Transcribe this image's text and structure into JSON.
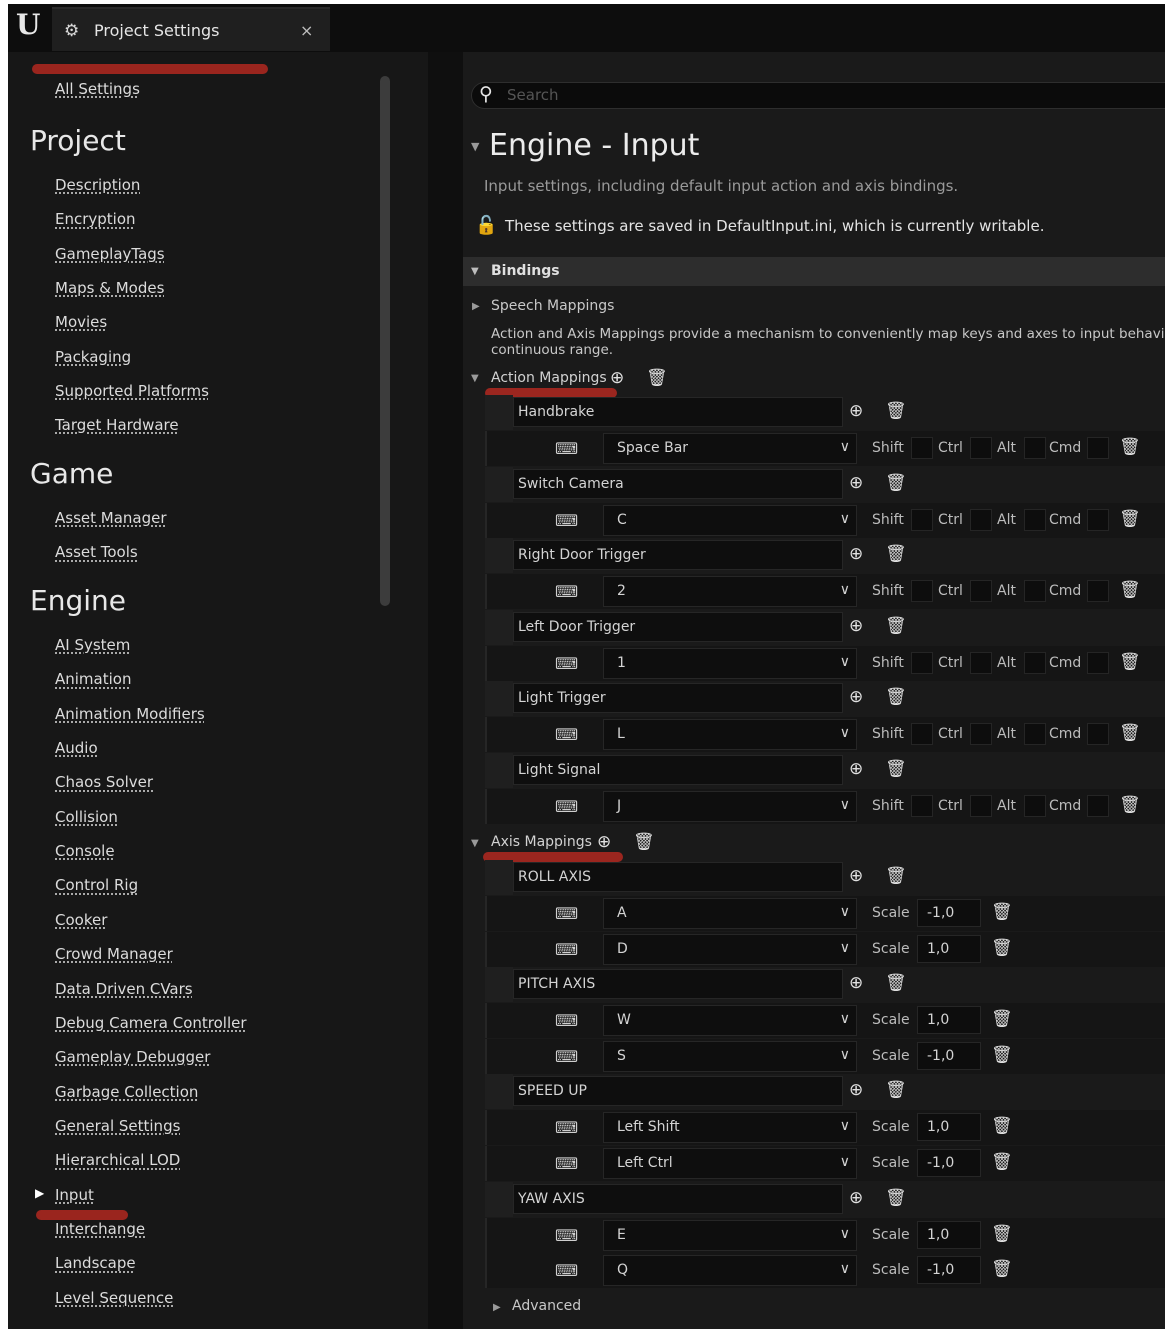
{
  "window": {
    "logo_text": "U",
    "tab_title": "Project Settings",
    "tab_close": "×"
  },
  "sidebar": {
    "all_settings": "All Settings",
    "project_heading": "Project",
    "project_items": [
      "Description",
      "Encryption",
      "GameplayTags",
      "Maps & Modes",
      "Movies",
      "Packaging",
      "Supported Platforms",
      "Target Hardware"
    ],
    "game_heading": "Game",
    "game_items": [
      "Asset Manager",
      "Asset Tools"
    ],
    "engine_heading": "Engine",
    "engine_items": [
      "AI System",
      "Animation",
      "Animation Modifiers",
      "Audio",
      "Chaos Solver",
      "Collision",
      "Console",
      "Control Rig",
      "Cooker",
      "Crowd Manager",
      "Data Driven CVars",
      "Debug Camera Controller",
      "Gameplay Debugger",
      "Garbage Collection",
      "General Settings",
      "Hierarchical LOD",
      "Input",
      "Interchange",
      "Landscape",
      "Level Sequence"
    ],
    "selected_item": "Input"
  },
  "main": {
    "search": {
      "placeholder": "Search",
      "value": ""
    },
    "section_title": "Engine - Input",
    "section_description": "Input settings, including default input action and axis bindings.",
    "saved_notice": "These settings are saved in DefaultInput.ini, which is currently writable.",
    "bindings_label": "Bindings",
    "speech_mappings_label": "Speech Mappings",
    "info_text": "Action and Axis Mappings provide a mechanism to conveniently map keys and axes to input behavior\ncontinuous range.",
    "action_mappings_label": "Action Mappings",
    "axis_mappings_label": "Axis Mappings",
    "modifier_labels": {
      "shift": "Shift",
      "ctrl": "Ctrl",
      "alt": "Alt",
      "cmd": "Cmd"
    },
    "scale_label": "Scale",
    "advanced_label": "Advanced",
    "action_mappings": [
      {
        "name": "Handbrake",
        "key": "Space Bar"
      },
      {
        "name": "Switch Camera",
        "key": "C"
      },
      {
        "name": "Right Door Trigger",
        "key": "2"
      },
      {
        "name": "Left Door Trigger",
        "key": "1"
      },
      {
        "name": "Light Trigger",
        "key": "L"
      },
      {
        "name": "Light Signal",
        "key": "J"
      }
    ],
    "axis_mappings": [
      {
        "name": "ROLL AXIS",
        "keys": [
          {
            "key": "A",
            "scale": "-1,0"
          },
          {
            "key": "D",
            "scale": "1,0"
          }
        ]
      },
      {
        "name": "PITCH AXIS",
        "keys": [
          {
            "key": "W",
            "scale": "1,0"
          },
          {
            "key": "S",
            "scale": "-1,0"
          }
        ]
      },
      {
        "name": "SPEED UP",
        "keys": [
          {
            "key": "Left Shift",
            "scale": "1,0"
          },
          {
            "key": "Left Ctrl",
            "scale": "-1,0"
          }
        ]
      },
      {
        "name": "YAW AXIS",
        "keys": [
          {
            "key": "E",
            "scale": "1,0"
          },
          {
            "key": "Q",
            "scale": "-1,0"
          }
        ]
      }
    ]
  },
  "icons": {
    "settings": "gear-icon",
    "close": "close-icon",
    "search": "search-icon",
    "lock": "unlock-icon",
    "add": "add-circle-icon",
    "remove": "trash-icon",
    "keyboard": "keyboard-icon",
    "dropdown": "chevron-down-icon"
  },
  "colors": {
    "annotation_red": "#a6271f",
    "panel_dark": "#171717",
    "field_dark": "#0e0e0e"
  }
}
